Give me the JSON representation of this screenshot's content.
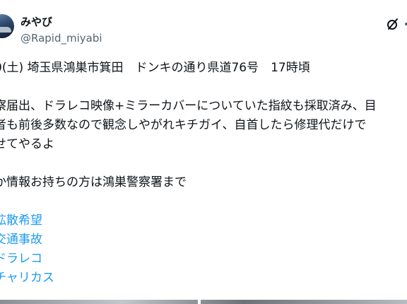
{
  "author": {
    "display_name": "みやび",
    "handle": "@Rapid_miyabi"
  },
  "icons": {
    "avatar": "avatar-image",
    "grok": "grok-slash-icon",
    "more": "more-icon"
  },
  "post": {
    "lines": [
      "0(土) 埼玉県鴻巣市箕田　ドンキの通り県道76号　17時頃",
      "察届出、ドラレコ映像+ミラーカバーについていた指紋も採取済み、目",
      "者も前後多数なので観念しやがれキチガイ、自首したら修理代だけで",
      "せてやるよ",
      "か情報お持ちの方は鴻巣警察署まで"
    ],
    "hashtags": [
      "拡散希望",
      "交通事故",
      "ドラレコ",
      "チャリカス"
    ]
  },
  "colors": {
    "text": "#0f1419",
    "secondary": "#536471",
    "link": "#1d9bf0"
  }
}
